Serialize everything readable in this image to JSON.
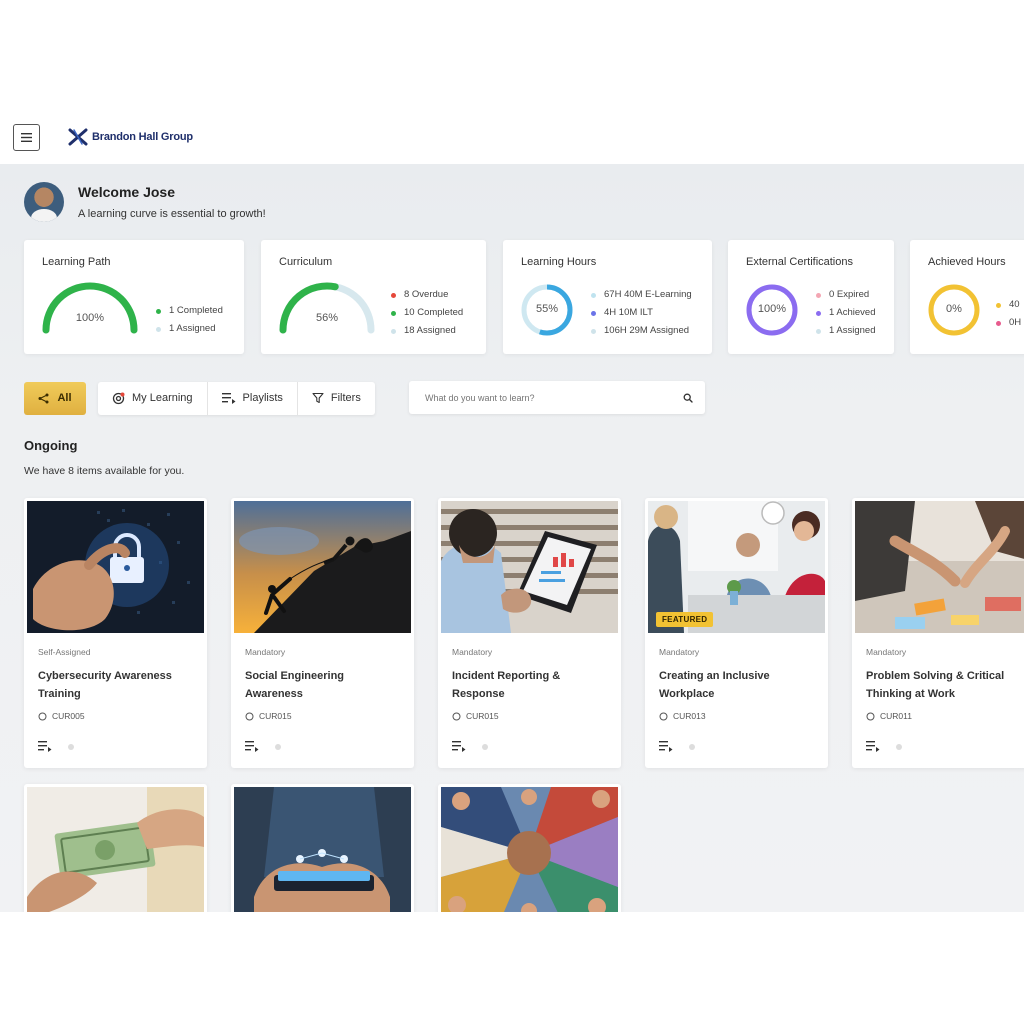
{
  "header": {
    "brand": "Brandon Hall Group"
  },
  "welcome": {
    "title": "Welcome Jose",
    "subtitle": "A learning curve is essential to growth!"
  },
  "stats": [
    {
      "title": "Learning Path",
      "ring_label": "100%",
      "ring_fraction": 1.0,
      "ring_color": "#2fb34a",
      "legend": [
        {
          "text": "1 Completed",
          "color": "#2fb34a"
        },
        {
          "text": "1 Assigned",
          "color": "#cfe3ea"
        }
      ]
    },
    {
      "title": "Curriculum",
      "ring_label": "56%",
      "ring_fraction": 0.56,
      "ring_color": "#2fb34a",
      "legend": [
        {
          "text": "8 Overdue",
          "color": "#e5483a"
        },
        {
          "text": "10 Completed",
          "color": "#2fb34a"
        },
        {
          "text": "18 Assigned",
          "color": "#cfe3ea"
        }
      ]
    },
    {
      "title": "Learning Hours",
      "ring_label": "55%",
      "ring_fraction": 0.55,
      "ring_color": "#3aa7e0",
      "legend": [
        {
          "text": "67H 40M E-Learning",
          "color": "#bfe3ef"
        },
        {
          "text": "4H 10M ILT",
          "color": "#6b74e8"
        },
        {
          "text": "106H 29M Assigned",
          "color": "#cfe3ea"
        }
      ]
    },
    {
      "title": "External Certifications",
      "ring_label": "100%",
      "ring_fraction": 1.0,
      "ring_color": "#8b6cf0",
      "legend": [
        {
          "text": "0 Expired",
          "color": "#f3a6b3"
        },
        {
          "text": "1 Achieved",
          "color": "#8b6cf0"
        },
        {
          "text": "1 Assigned",
          "color": "#cfe3ea"
        }
      ]
    },
    {
      "title": "Achieved Hours",
      "ring_label": "0%",
      "ring_fraction": 0.0,
      "ring_color": "#f2c233",
      "legend": [
        {
          "text": "40",
          "color": "#f2c233"
        },
        {
          "text": "0H",
          "color": "#e75b8d"
        }
      ]
    }
  ],
  "toolbar": {
    "all": "All",
    "my_learning": "My Learning",
    "playlists": "Playlists",
    "filters": "Filters",
    "search_placeholder": "What do you want to learn?"
  },
  "ongoing": {
    "title": "Ongoing",
    "subtitle": "We have 8 items available for you."
  },
  "cards": [
    {
      "type": "Self-Assigned",
      "title": "Cybersecurity Awareness Training",
      "code": "CUR005"
    },
    {
      "type": "Mandatory",
      "title": "Social Engineering Awareness",
      "code": "CUR015"
    },
    {
      "type": "Mandatory",
      "title": "Incident Reporting & Response",
      "code": "CUR015"
    },
    {
      "type": "Mandatory",
      "title": "Creating an Inclusive Workplace",
      "code": "CUR013",
      "badge": "FEATURED"
    },
    {
      "type": "Mandatory",
      "title": "Problem Solving & Critical Thinking at Work",
      "code": "CUR011"
    }
  ]
}
